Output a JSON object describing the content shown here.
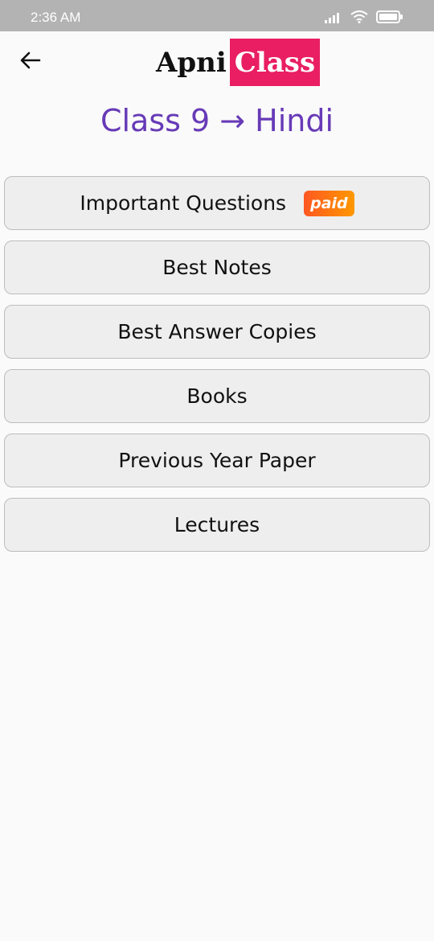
{
  "status_bar": {
    "time": "2:36 AM",
    "icons": [
      "signal-icon",
      "wifi-icon",
      "battery-icon"
    ]
  },
  "header": {
    "back_icon": "arrow-left-icon",
    "logo": {
      "part1": "Apni",
      "part2": "Class",
      "accent_color": "#e91e63"
    }
  },
  "page": {
    "title": "Class 9 → Hindi",
    "title_color": "#673ab7"
  },
  "menu": {
    "items": [
      {
        "label": "Important Questions",
        "badge": "paid"
      },
      {
        "label": "Best Notes"
      },
      {
        "label": "Best Answer Copies"
      },
      {
        "label": "Books"
      },
      {
        "label": "Previous Year Paper"
      },
      {
        "label": "Lectures"
      }
    ]
  }
}
